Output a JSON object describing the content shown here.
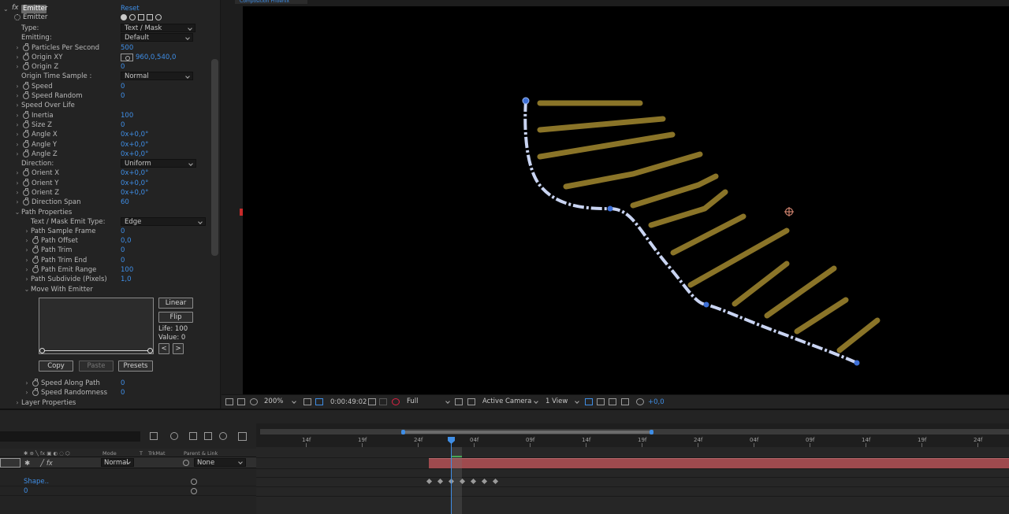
{
  "effect_controls": {
    "effect_name": "Emitter",
    "reset_label": "Reset",
    "sub_name": "Emitter",
    "rows": [
      {
        "label": "Type:",
        "value": "Text / Mask",
        "kind": "dropdown"
      },
      {
        "label": "Emitting:",
        "value": "Default",
        "kind": "dropdown"
      },
      {
        "label": "Particles Per Second",
        "value": "500",
        "kind": "value"
      },
      {
        "label": "Origin XY",
        "value": "960,0,540,0",
        "kind": "point"
      },
      {
        "label": "Origin Z",
        "value": "0",
        "kind": "value"
      },
      {
        "label": "Origin Time Sample :",
        "value": "Normal",
        "kind": "dropdown"
      },
      {
        "label": "Speed",
        "value": "0",
        "kind": "value"
      },
      {
        "label": "Speed Random",
        "value": "0",
        "kind": "value"
      },
      {
        "label": "Speed Over Life",
        "value": "",
        "kind": "group"
      },
      {
        "label": "Inertia",
        "value": "100",
        "kind": "value"
      },
      {
        "label": "Size Z",
        "value": "0",
        "kind": "value"
      },
      {
        "label": "Angle X",
        "value": "0x+0,0°",
        "kind": "value"
      },
      {
        "label": "Angle Y",
        "value": "0x+0,0°",
        "kind": "value"
      },
      {
        "label": "Angle Z",
        "value": "0x+0,0°",
        "kind": "value"
      },
      {
        "label": "Direction:",
        "value": "Uniform",
        "kind": "dropdown"
      },
      {
        "label": "Orient X",
        "value": "0x+0,0°",
        "kind": "value"
      },
      {
        "label": "Orient Y",
        "value": "0x+0,0°",
        "kind": "value"
      },
      {
        "label": "Orient Z",
        "value": "0x+0,0°",
        "kind": "value"
      },
      {
        "label": "Direction Span",
        "value": "60",
        "kind": "value"
      },
      {
        "label": "Path Properties",
        "value": "",
        "kind": "group"
      },
      {
        "label": "Text / Mask Emit Type:",
        "value": "Edge",
        "kind": "dropdown"
      },
      {
        "label": "Path Sample Frame",
        "value": "0",
        "kind": "value"
      },
      {
        "label": "Path Offset",
        "value": "0,0",
        "kind": "value"
      },
      {
        "label": "Path Trim",
        "value": "0",
        "kind": "value"
      },
      {
        "label": "Path Trim End",
        "value": "0",
        "kind": "value"
      },
      {
        "label": "Path Emit Range",
        "value": "100",
        "kind": "value"
      },
      {
        "label": "Path Subdivide (Pixels)",
        "value": "1,0",
        "kind": "value"
      },
      {
        "label": "Move With Emitter",
        "value": "",
        "kind": "group"
      },
      {
        "label": "Speed Along Path",
        "value": "0",
        "kind": "value"
      },
      {
        "label": "Speed Randomness",
        "value": "0",
        "kind": "value"
      },
      {
        "label": "Layer Properties",
        "value": "",
        "kind": "group"
      }
    ],
    "graph": {
      "linear_label": "Linear",
      "flip_label": "Flip",
      "life_text": "Life: 100",
      "value_text": "Value: 0",
      "prev_label": "<",
      "next_label": ">",
      "copy_label": "Copy",
      "paste_label": "Paste",
      "presets_label": "Presets"
    }
  },
  "viewer": {
    "tab_label": "Composition Pnoenix",
    "zoom": "200%",
    "timecode": "0:00:49:02",
    "resolution": "Full",
    "camera": "Active Camera",
    "views": "1 View",
    "exposure": "+0,0"
  },
  "timeline": {
    "headers": {
      "mode": "Mode",
      "t": "T",
      "trkmat": "TrkMat",
      "parent": "Parent & Link"
    },
    "layer": {
      "mode": "Normal",
      "parent": "None"
    },
    "props": [
      {
        "label": "Shape.."
      },
      {
        "label": "0"
      }
    ],
    "ruler_labels": [
      "14f",
      "19f",
      "24f",
      "04f",
      "09f",
      "14f",
      "19f",
      "24f",
      "04f",
      "09f",
      "14f",
      "19f",
      "24f"
    ]
  },
  "colors": {
    "accent": "#3f8ee6",
    "stroke": "#8a7428",
    "path": "#c9d4f2",
    "layer_bar": "#9e4a4e"
  }
}
